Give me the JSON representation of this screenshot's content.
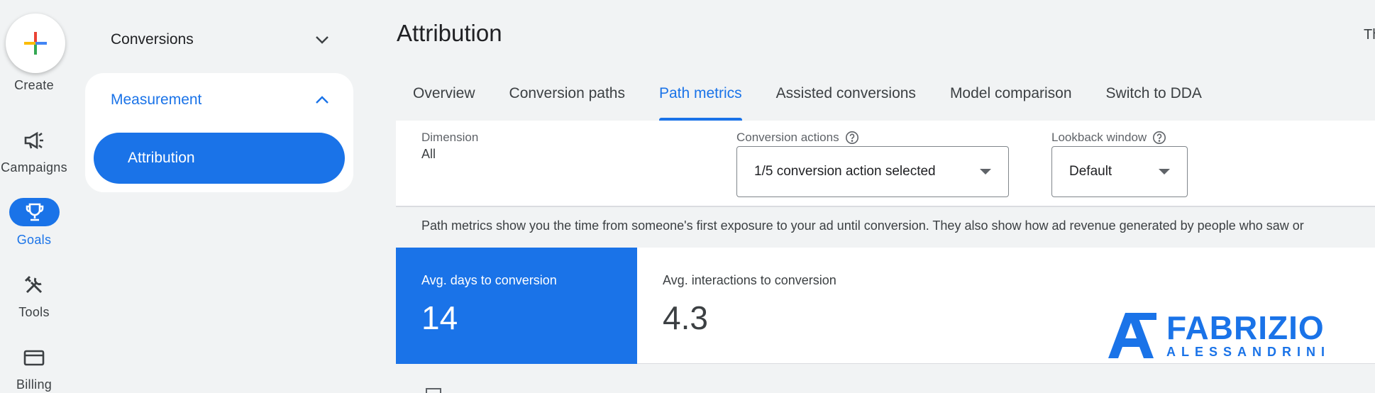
{
  "rail": {
    "create_label": "Create",
    "items": [
      {
        "label": "Campaigns",
        "icon": "megaphone-icon"
      },
      {
        "label": "Goals",
        "icon": "trophy-icon"
      },
      {
        "label": "Tools",
        "icon": "tools-icon"
      },
      {
        "label": "Billing",
        "icon": "credit-card-icon"
      }
    ]
  },
  "nav": {
    "conversions_label": "Conversions",
    "measurement_label": "Measurement",
    "attribution_label": "Attribution"
  },
  "page": {
    "title": "Attribution",
    "top_right_text": "Th"
  },
  "tabs": [
    {
      "label": "Overview"
    },
    {
      "label": "Conversion paths"
    },
    {
      "label": "Path metrics",
      "active": true
    },
    {
      "label": "Assisted conversions"
    },
    {
      "label": "Model comparison"
    },
    {
      "label": "Switch to DDA"
    }
  ],
  "filters": {
    "dimension_label": "Dimension",
    "dimension_value": "All",
    "conversion_actions_label": "Conversion actions",
    "conversion_actions_value": "1/5 conversion action selected",
    "lookback_label": "Lookback window",
    "lookback_value": "Default"
  },
  "description": "Path metrics show you the time from someone's first exposure to your ad until conversion. They also show how ad revenue generated by people who saw or",
  "metrics": [
    {
      "label": "Avg. days to conversion",
      "value": "14"
    },
    {
      "label": "Avg. interactions to conversion",
      "value": "4.3"
    }
  ],
  "watermark": {
    "name": "FABRIZIO",
    "surname": "ALESSANDRINI"
  },
  "colors": {
    "accent": "#1a73e8",
    "background": "#f1f3f4"
  }
}
